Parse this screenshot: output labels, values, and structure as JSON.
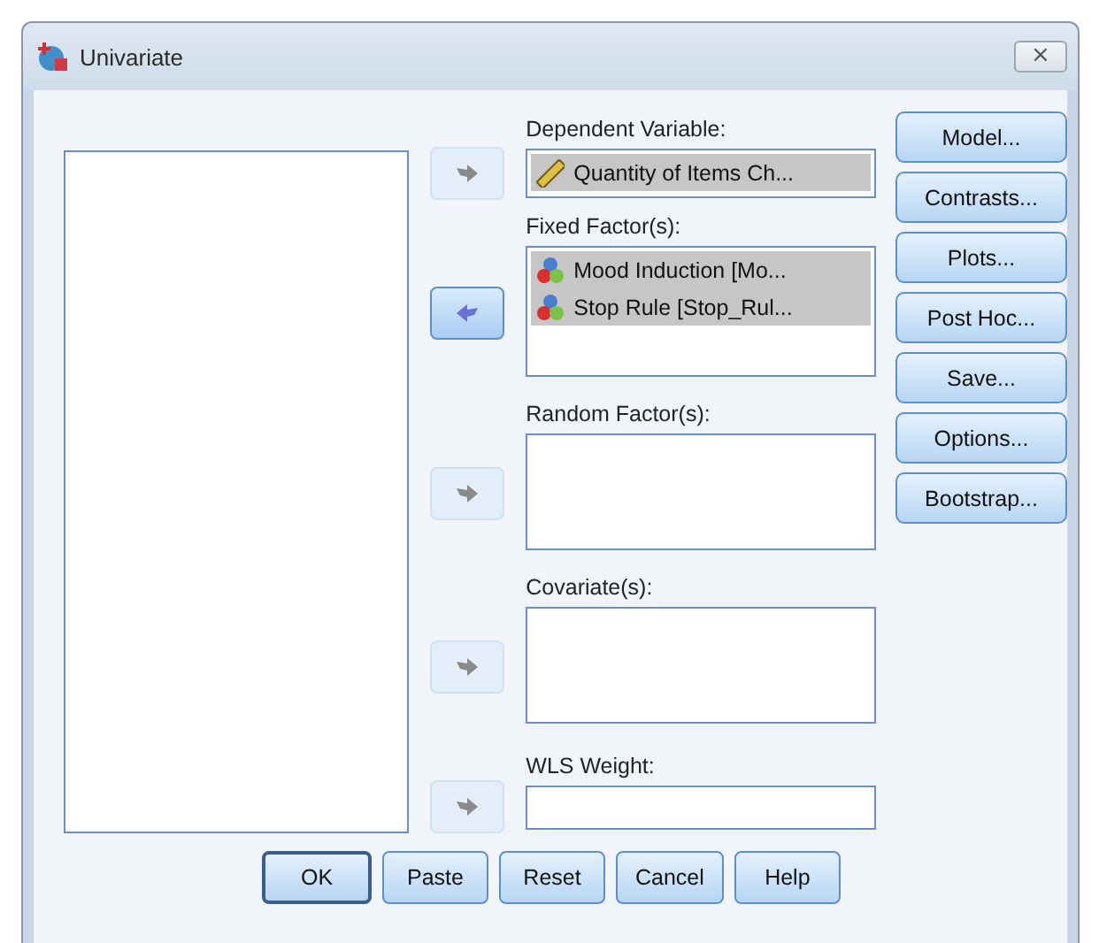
{
  "window": {
    "title": "Univariate",
    "close": "⨯"
  },
  "sections": [
    {
      "label": "Dependent Variable:",
      "kind": "field",
      "move_back": false,
      "items": [
        {
          "kind": "scale",
          "text": "Quantity of Items Ch...",
          "selected": true
        }
      ]
    },
    {
      "label": "Fixed Factor(s):",
      "kind": "list",
      "move_back": true,
      "items": [
        {
          "kind": "nominal",
          "text": "Mood Induction [Mo...",
          "selected": true
        },
        {
          "kind": "nominal",
          "text": "Stop Rule [Stop_Rul...",
          "selected": true
        }
      ]
    },
    {
      "label": "Random Factor(s):",
      "kind": "list",
      "move_back": false
    },
    {
      "label": "Covariate(s):",
      "kind": "list",
      "move_back": false
    },
    {
      "label": "WLS Weight:",
      "kind": "field",
      "move_back": false
    }
  ],
  "side_buttons": [
    "Model...",
    "Contrasts...",
    "Plots...",
    "Post Hoc...",
    "Save...",
    "Options...",
    "Bootstrap..."
  ],
  "bottom_buttons": [
    {
      "label": "OK",
      "default": true
    },
    {
      "label": "Paste",
      "default": false
    },
    {
      "label": "Reset",
      "default": false
    },
    {
      "label": "Cancel",
      "default": false
    },
    {
      "label": "Help",
      "default": false
    }
  ]
}
